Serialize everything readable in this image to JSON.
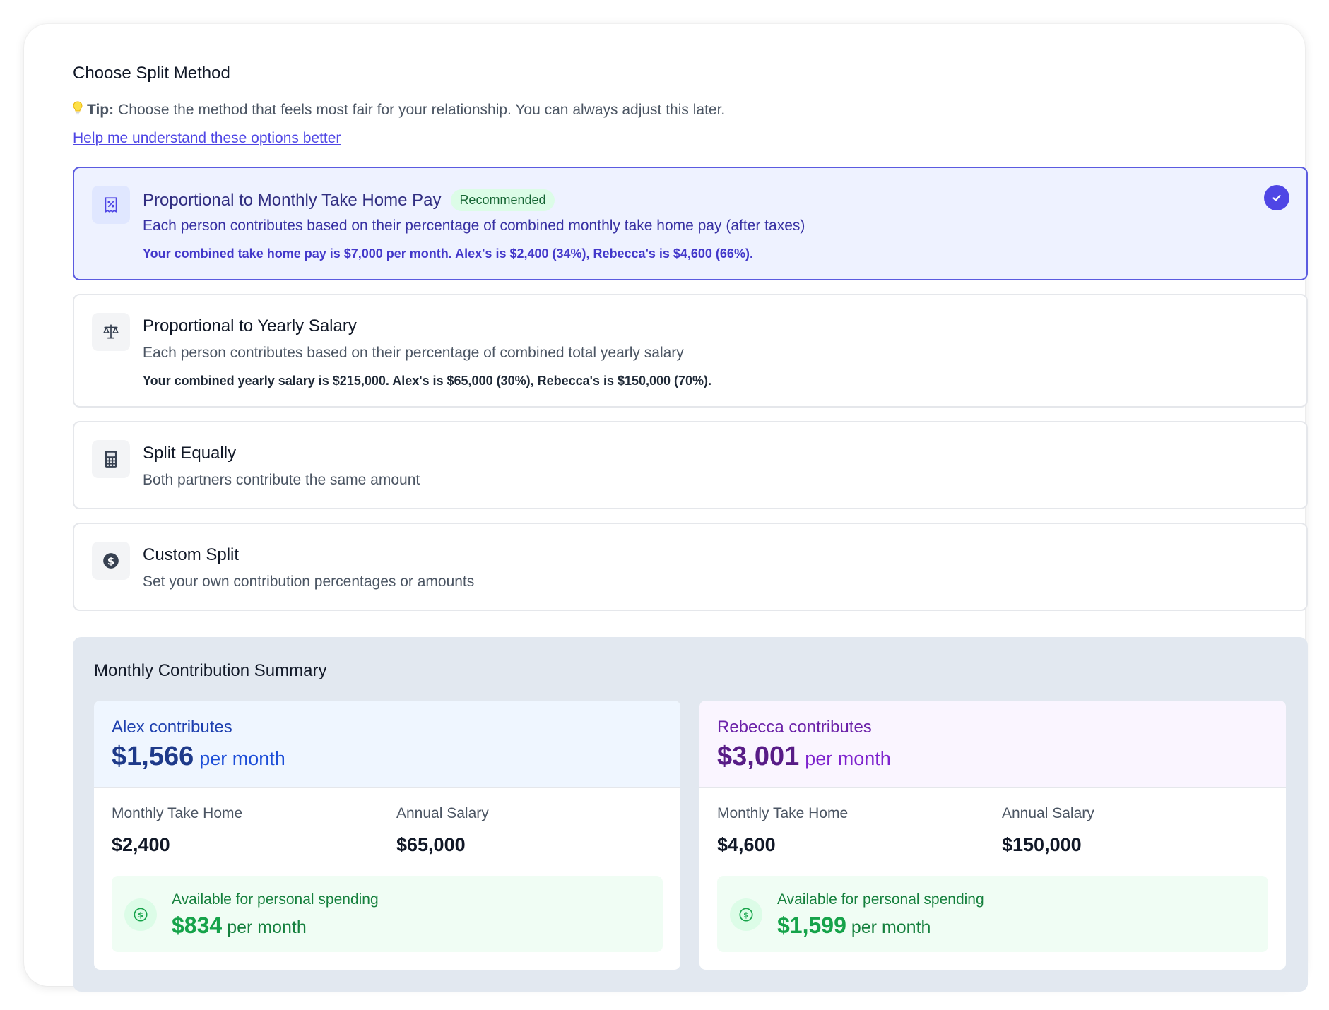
{
  "header": {
    "title": "Choose Split Method",
    "tip_label": "Tip:",
    "tip_text": "Choose the method that feels most fair for your relationship. You can always adjust this later.",
    "help_link": "Help me understand these options better"
  },
  "options": [
    {
      "title": "Proportional to Monthly Take Home Pay",
      "badge": "Recommended",
      "description": "Each person contributes based on their percentage of combined monthly take home pay (after taxes)",
      "detail": "Your combined take home pay is $7,000 per month. Alex's is $2,400 (34%), Rebecca's is $4,600 (66%).",
      "icon": "receipt-percent-icon",
      "selected": true
    },
    {
      "title": "Proportional to Yearly Salary",
      "description": "Each person contributes based on their percentage of combined total yearly salary",
      "detail": "Your combined yearly salary is $215,000. Alex's is $65,000 (30%), Rebecca's is $150,000 (70%).",
      "icon": "scale-icon",
      "selected": false
    },
    {
      "title": "Split Equally",
      "description": "Both partners contribute the same amount",
      "icon": "calculator-icon",
      "selected": false
    },
    {
      "title": "Custom Split",
      "description": "Set your own contribution percentages or amounts",
      "icon": "dollar-circle-icon",
      "selected": false
    }
  ],
  "summary": {
    "title": "Monthly Contribution Summary",
    "partners": [
      {
        "name_label": "Alex contributes",
        "amount": "$1,566",
        "amount_unit": "per month",
        "take_home_label": "Monthly Take Home",
        "take_home_value": "$2,400",
        "salary_label": "Annual Salary",
        "salary_value": "$65,000",
        "available_label": "Available for personal spending",
        "available_amount": "$834",
        "available_unit": "per month",
        "theme": {
          "bg": "#eff6ff",
          "name": "#1e40af",
          "amount": "#1e3a8a",
          "unit": "#1d4ed8"
        }
      },
      {
        "name_label": "Rebecca contributes",
        "amount": "$3,001",
        "amount_unit": "per month",
        "take_home_label": "Monthly Take Home",
        "take_home_value": "$4,600",
        "salary_label": "Annual Salary",
        "salary_value": "$150,000",
        "available_label": "Available for personal spending",
        "available_amount": "$1,599",
        "available_unit": "per month",
        "theme": {
          "bg": "#faf5ff",
          "name": "#6b21a8",
          "amount": "#581c87",
          "unit": "#7e22ce"
        }
      }
    ]
  },
  "colors": {
    "accent": "#4f46e5",
    "selected_bg": "#eef2ff",
    "badge_bg": "#dcfce7",
    "success": "#16a34a"
  }
}
